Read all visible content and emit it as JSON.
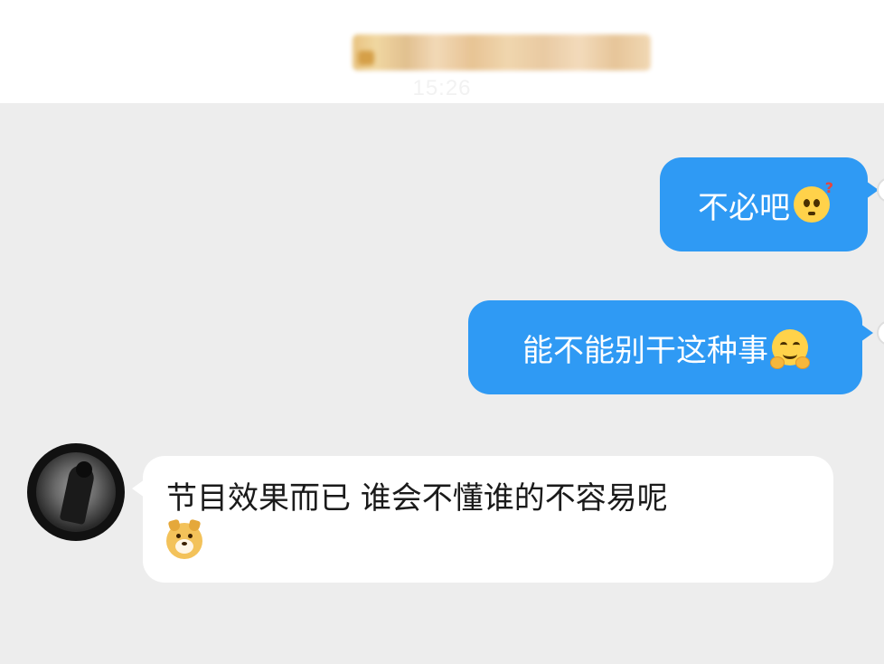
{
  "chat": {
    "header": {
      "blurred_title_icon": "blurred-contact-title",
      "timestamp": "15:26"
    },
    "messages": [
      {
        "id": "m1",
        "direction": "outgoing",
        "text": "不必吧",
        "emoji": "confused-face-with-question-mark",
        "bubble_color": "#2f9af4"
      },
      {
        "id": "m2",
        "direction": "outgoing",
        "text": "能不能别干这种事",
        "emoji": "hugging-face",
        "bubble_color": "#2f9af4"
      },
      {
        "id": "m3",
        "direction": "incoming",
        "text": "节目效果而已  谁会不懂谁的不容易呢",
        "emoji": "doge-face",
        "bubble_color": "#ffffff",
        "avatar": "dark-moon-silhouette-avatar"
      }
    ]
  },
  "colors": {
    "chat_background": "#ededed",
    "header_background": "#ffffff",
    "outgoing_bubble": "#2f9af4",
    "incoming_bubble": "#ffffff",
    "outgoing_text": "#ffffff",
    "incoming_text": "#1a1a1a"
  }
}
